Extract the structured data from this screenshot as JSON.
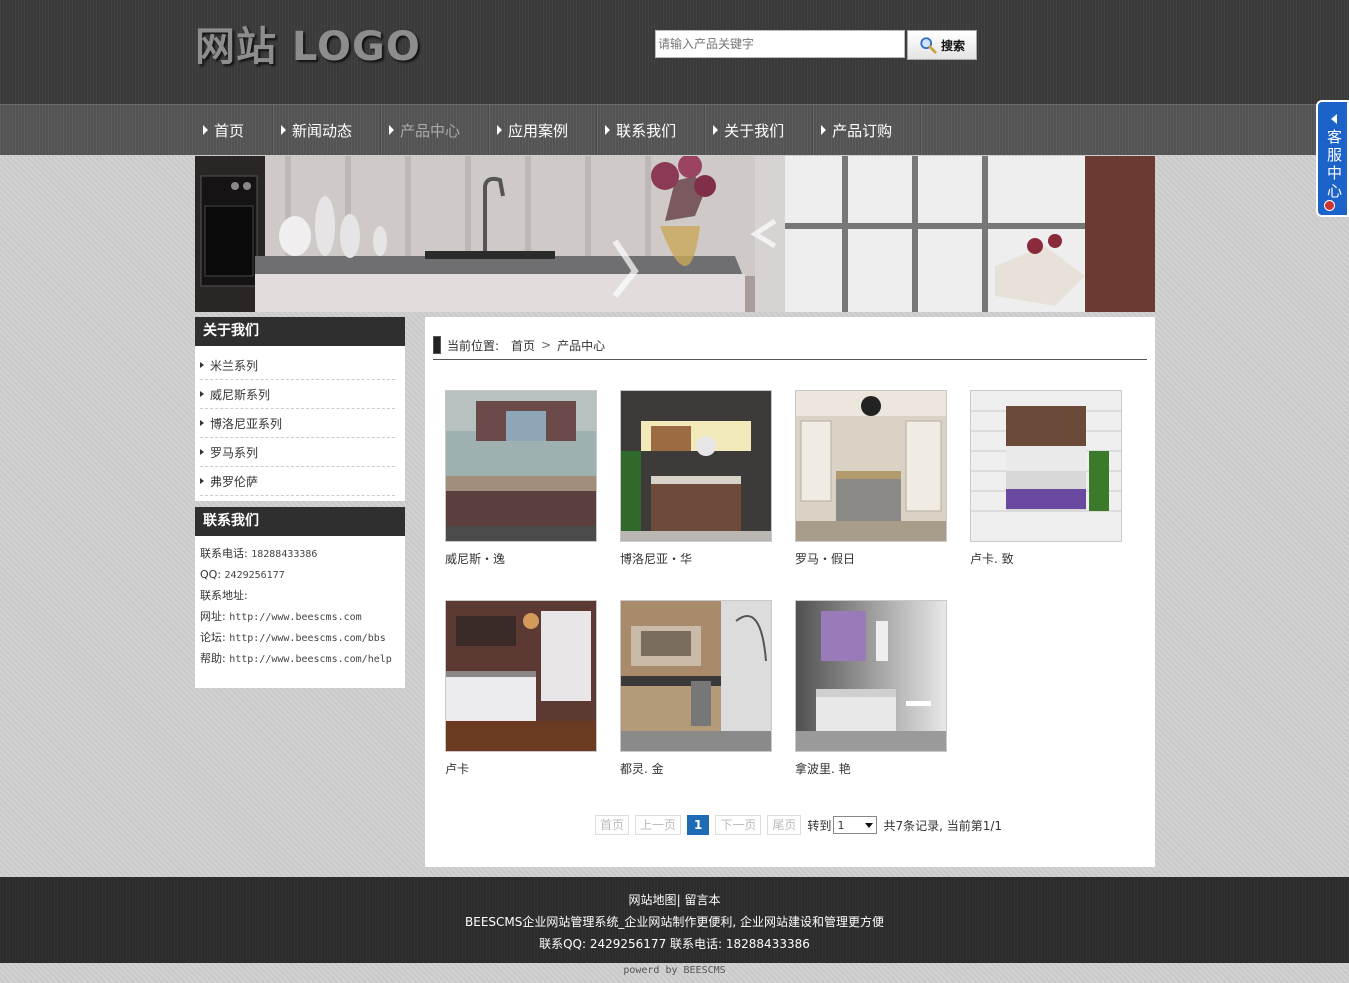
{
  "header": {
    "logo_text": "网站 LOGO",
    "search_placeholder": "请输入产品关键字",
    "search_button": "搜索"
  },
  "nav": {
    "items": [
      {
        "label": "首页"
      },
      {
        "label": "新闻动态"
      },
      {
        "label": "产品中心",
        "active": true
      },
      {
        "label": "应用案例"
      },
      {
        "label": "联系我们"
      },
      {
        "label": "关于我们"
      },
      {
        "label": "产品订购"
      }
    ]
  },
  "sidebar": {
    "about_title": "关于我们",
    "categories": [
      "米兰系列",
      "威尼斯系列",
      "博洛尼亚系列",
      "罗马系列",
      "弗罗伦萨"
    ],
    "contact_title": "联系我们",
    "contact": [
      {
        "label": "联系电话:",
        "value": "18288433386"
      },
      {
        "label": "QQ:",
        "value": "2429256177"
      },
      {
        "label": "联系地址:",
        "value": ""
      },
      {
        "label": "网址:",
        "value": "http://www.beescms.com"
      },
      {
        "label": "论坛:",
        "value": "http://www.beescms.com/bbs"
      },
      {
        "label": "帮助:",
        "value": "http://www.beescms.com/help"
      }
    ]
  },
  "breadcrumb": {
    "prefix": "当前位置:",
    "home": "首页",
    "separator": ">",
    "current": "产品中心"
  },
  "products": [
    {
      "name": "威尼斯・逸"
    },
    {
      "name": "博洛尼亚・华"
    },
    {
      "name": "罗马・假日"
    },
    {
      "name": "卢卡. 致"
    },
    {
      "name": "卢卡"
    },
    {
      "name": "都灵. 金"
    },
    {
      "name": "拿波里. 艳"
    }
  ],
  "pager": {
    "first": "首页",
    "prev": "上一页",
    "current": "1",
    "next": "下一页",
    "last": "尾页",
    "goto": "转到",
    "select_value": "1",
    "info": "共7条记录, 当前第1/1"
  },
  "footer": {
    "sitemap": "网站地图",
    "sep": "|",
    "guestbook": "留言本",
    "slogan": "BEESCMS企业网站管理系统_企业网站制作更便利, 企业网站建设和管理更方便",
    "contact_line": "联系QQ: 2429256177 联系电话: 18288433386",
    "powered": "powerd by BEESCMS"
  },
  "service": {
    "label": "客服中心"
  },
  "colors": {
    "header_bg": "#3c3c3c",
    "nav_bg": "#575757",
    "side_title_bg": "#2f2f2f",
    "pager_current": "#1f6bb5",
    "service_bg": "#1b63c8",
    "footer_bg": "#2e2e2e"
  }
}
